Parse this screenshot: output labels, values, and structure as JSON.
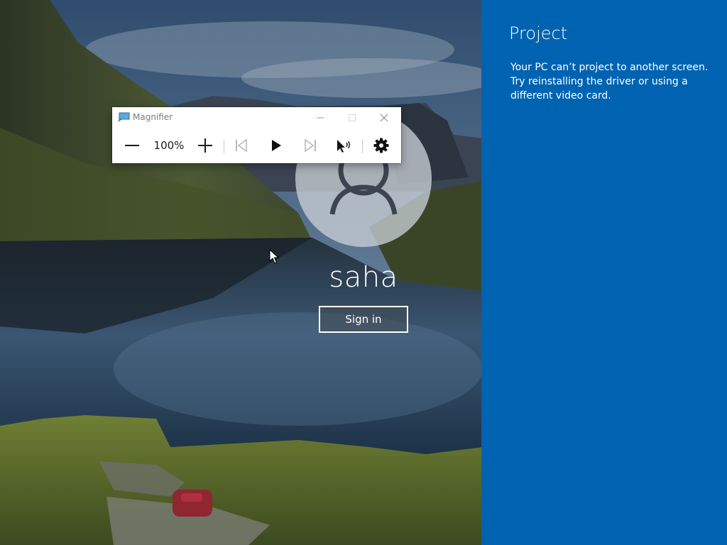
{
  "lock_screen": {
    "user_name": "saha",
    "sign_in_label": "Sign in"
  },
  "magnifier": {
    "title": "Magnifier",
    "zoom_level": "100%",
    "icons": {
      "app": "magnifier-app-icon",
      "minimize": "minimize-icon",
      "maximize": "maximize-icon",
      "close": "close-icon",
      "zoom_out": "minus-icon",
      "zoom_in": "plus-icon",
      "previous": "skip-previous-icon",
      "play": "play-icon",
      "next": "skip-next-icon",
      "read_from_here": "read-from-here-icon",
      "settings": "gear-icon"
    }
  },
  "project_panel": {
    "title": "Project",
    "message": "Your PC can’t project to another screen. Try reinstalling the driver or using a different video card."
  },
  "colors": {
    "project_panel_bg": "#0063b1",
    "magnifier_bg": "#ffffff",
    "text_on_dark": "#ffffff"
  }
}
